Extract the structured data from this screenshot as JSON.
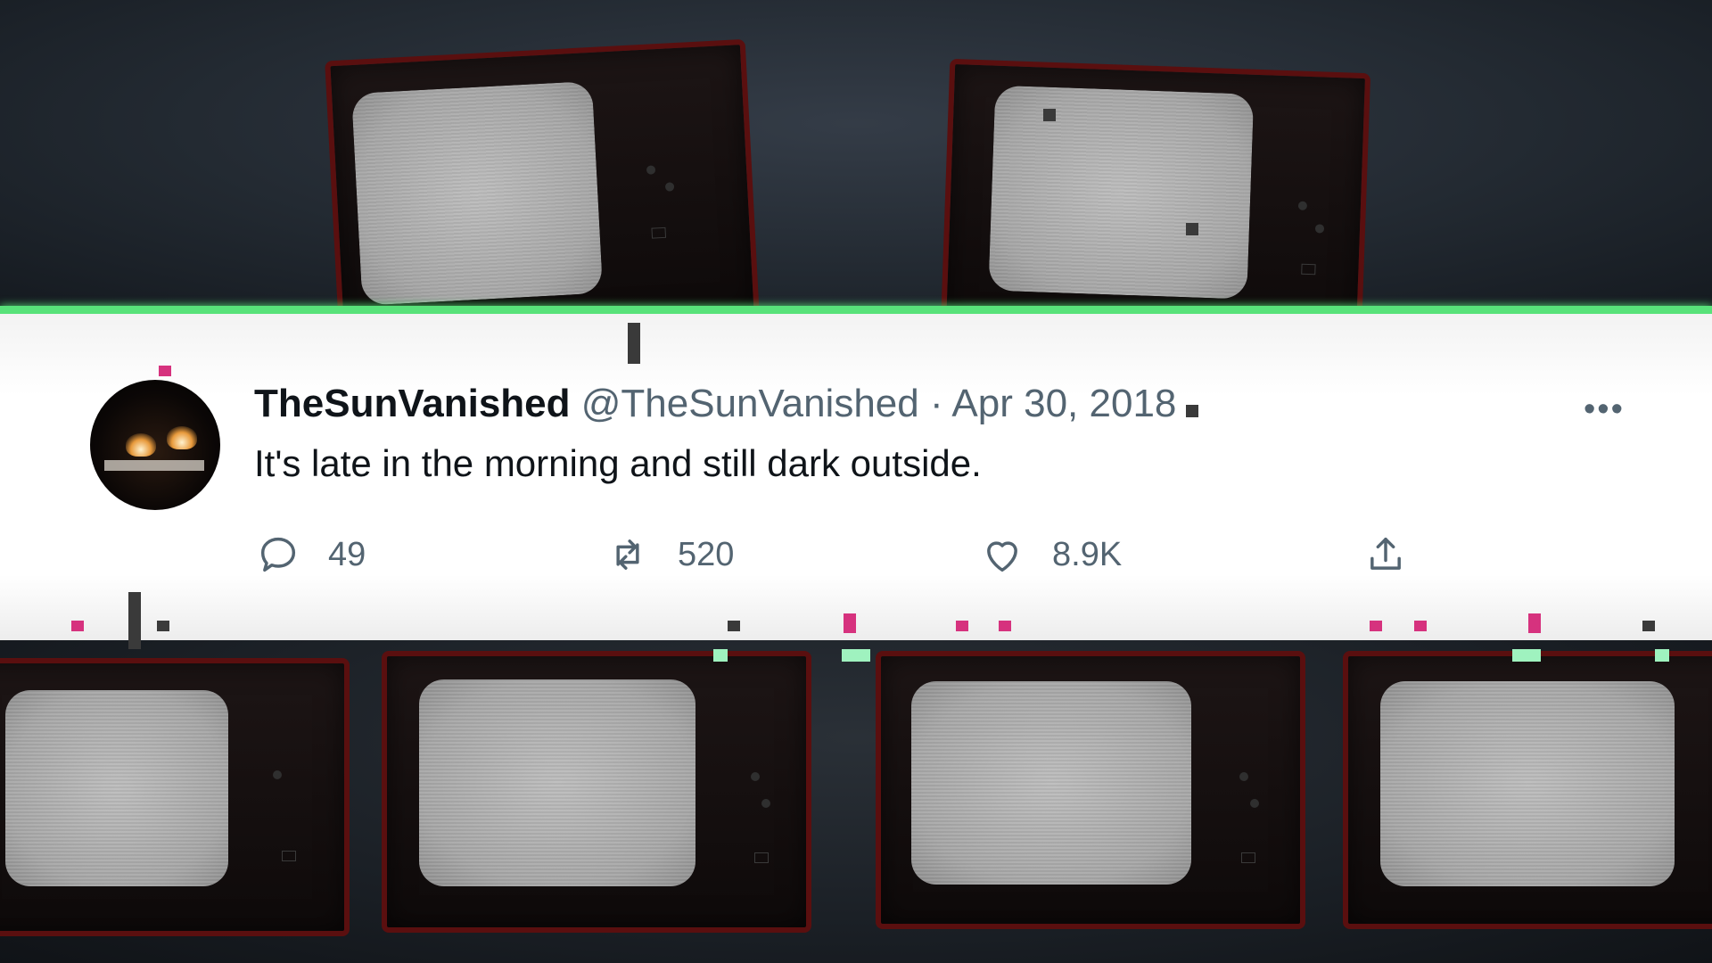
{
  "tweet": {
    "display_name": "TheSunVanished",
    "handle": "@TheSunVanished",
    "separator": "·",
    "date": "Apr 30, 2018",
    "text": "It's late in the morning and still dark outside.",
    "more_label": "•••",
    "actions": {
      "reply": {
        "icon": "reply-icon",
        "count": "49"
      },
      "retweet": {
        "icon": "retweet-icon",
        "count": "520"
      },
      "like": {
        "icon": "heart-icon",
        "count": "8.9K"
      },
      "share": {
        "icon": "share-icon"
      }
    }
  },
  "colors": {
    "accent_line": "#58e27a",
    "tv_frame": "#5a0f0f",
    "text_primary": "#0f1419",
    "text_secondary": "#536471",
    "glitch_pink": "#d6327e",
    "glitch_green": "#9ff2bf"
  }
}
